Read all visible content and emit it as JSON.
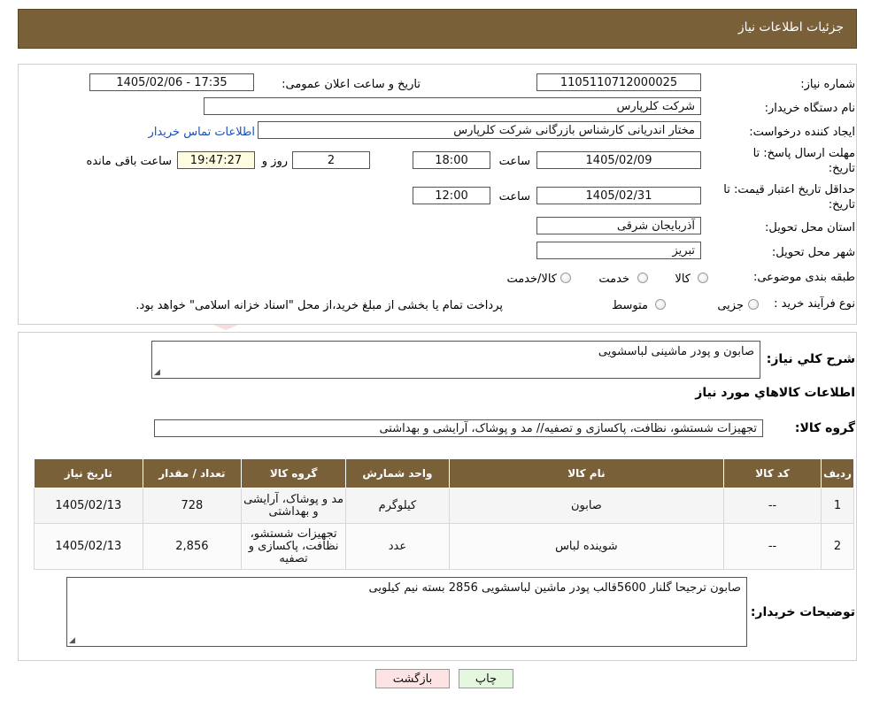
{
  "header": {
    "title": "جزئیات اطلاعات نیاز"
  },
  "form": {
    "need_number_label": "شماره نیاز:",
    "need_number": "1105110712000025",
    "announce_label": "تاریخ و ساعت اعلان عمومی:",
    "announce_value": "1405/02/06 - 17:35",
    "buyer_org_label": "نام دستگاه خریدار:",
    "buyer_org": "شرکت کلرپارس",
    "requester_label": "ایجاد کننده درخواست:",
    "requester": "مختار اندریانی کارشناس بازرگانی شرکت کلرپارس",
    "contact_link": "اطلاعات تماس خریدار",
    "deadline_label_1": "مهلت ارسال پاسخ: تا",
    "deadline_label_2": "تاریخ:",
    "deadline_date": "1405/02/09",
    "time_label": "ساعت",
    "deadline_time": "18:00",
    "days_value": "2",
    "days_label": "روز و",
    "remaining_time": "19:47:27",
    "remaining_label": "ساعت باقی مانده",
    "validity_label_1": "حداقل تاریخ اعتبار قیمت: تا",
    "validity_label_2": "تاریخ:",
    "validity_date": "1405/02/31",
    "validity_time": "12:00",
    "province_label": "استان محل تحویل:",
    "province": "آذربایجان شرقی",
    "city_label": "شهر محل تحویل:",
    "city": "تبریز",
    "category_label": "طبقه بندی موضوعی:",
    "category_options": [
      "کالا",
      "خدمت",
      "کالا/خدمت"
    ],
    "process_label": "نوع فرآیند خرید :",
    "process_options": [
      "جزیی",
      "متوسط"
    ],
    "process_note": "پرداخت تمام یا بخشی از مبلغ خرید،از محل \"اسناد خزانه اسلامی\" خواهد بود."
  },
  "details": {
    "summary_label": "شرح کلي نياز:",
    "summary": "صابون و پودر ماشینی لباسشویی",
    "items_heading": "اطلاعات کالاهاي مورد نياز",
    "group_label": "گروه کالا:",
    "group_value": "تجهیزات شستشو، نظافت، پاکسازی و تصفیه// مد و پوشاک، آرایشی و بهداشتی",
    "table": {
      "headers": [
        "ردیف",
        "کد کالا",
        "نام کالا",
        "واحد شمارش",
        "گروه کالا",
        "تعداد / مقدار",
        "تاریخ نیاز"
      ],
      "rows": [
        [
          "1",
          "--",
          "صابون",
          "کیلوگرم",
          "مد و پوشاک، آرایشی و بهداشتی",
          "728",
          "1405/02/13"
        ],
        [
          "2",
          "--",
          "شوینده لباس",
          "عدد",
          "تجهیزات شستشو، نظافت، پاکسازی و تصفیه",
          "2,856",
          "1405/02/13"
        ]
      ]
    },
    "buyer_notes_label": "توضیحات خریدار:",
    "buyer_notes": "صابون ترجیحا گلنار 5600قالب پودر ماشین لباسشویی 2856 بسته نیم کیلویی"
  },
  "buttons": {
    "print": "چاپ",
    "back": "بازگشت"
  },
  "colors": {
    "header_bg": "#7a6038",
    "back_btn_bg": "#fde3e3",
    "print_btn_bg": "#e6f7e0",
    "link": "#1a4fb5"
  }
}
